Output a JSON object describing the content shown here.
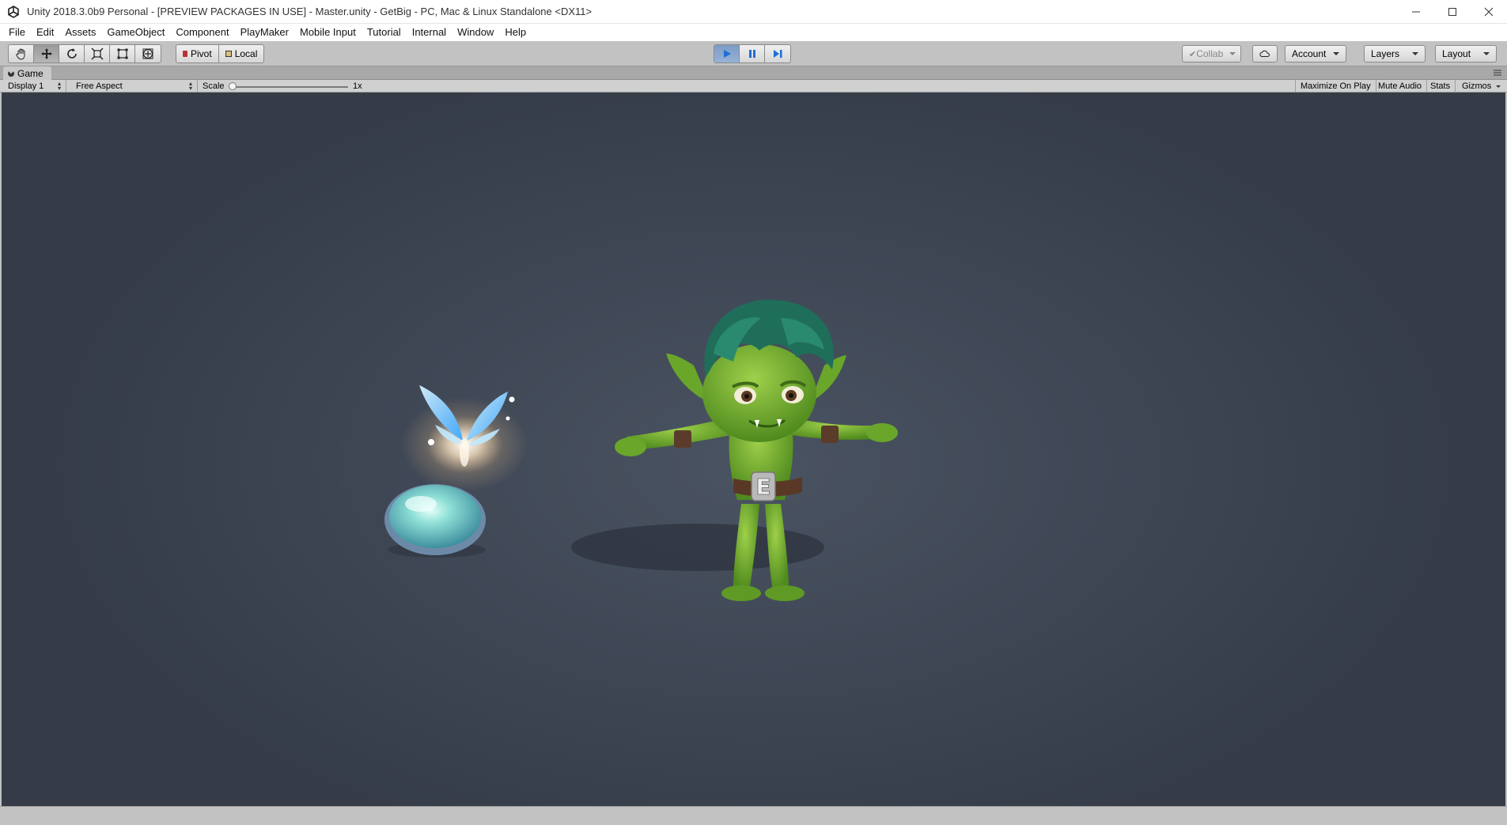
{
  "window": {
    "title": "Unity 2018.3.0b9 Personal - [PREVIEW PACKAGES IN USE] - Master.unity - GetBig - PC, Mac & Linux Standalone <DX11>"
  },
  "menu": [
    "File",
    "Edit",
    "Assets",
    "GameObject",
    "Component",
    "PlayMaker",
    "Mobile Input",
    "Tutorial",
    "Internal",
    "Window",
    "Help"
  ],
  "toolbar": {
    "tools": [
      "hand-tool",
      "move-tool",
      "rotate-tool",
      "scale-tool",
      "rect-tool",
      "transform-tool"
    ],
    "active_tool": "move-tool",
    "pivot_label": "Pivot",
    "local_label": "Local",
    "play_state": "playing",
    "collab_label": "Collab",
    "account_label": "Account",
    "layers_label": "Layers",
    "layout_label": "Layout"
  },
  "game_tab": {
    "label": "Game",
    "display": "Display 1",
    "aspect": "Free Aspect",
    "scale_label": "Scale",
    "scale_value": "1x",
    "maximize_label": "Maximize On Play",
    "mute_label": "Mute Audio",
    "stats_label": "Stats",
    "gizmos_label": "Gizmos"
  },
  "scene": {
    "character_belt_letter": "E"
  },
  "colors": {
    "viewport_bg": "#3e4654",
    "goblin_skin": "#6aa62a",
    "goblin_hair": "#1f6e5a",
    "fairy_glow": "#8fd8ff",
    "orb": "#7fd4d0"
  }
}
